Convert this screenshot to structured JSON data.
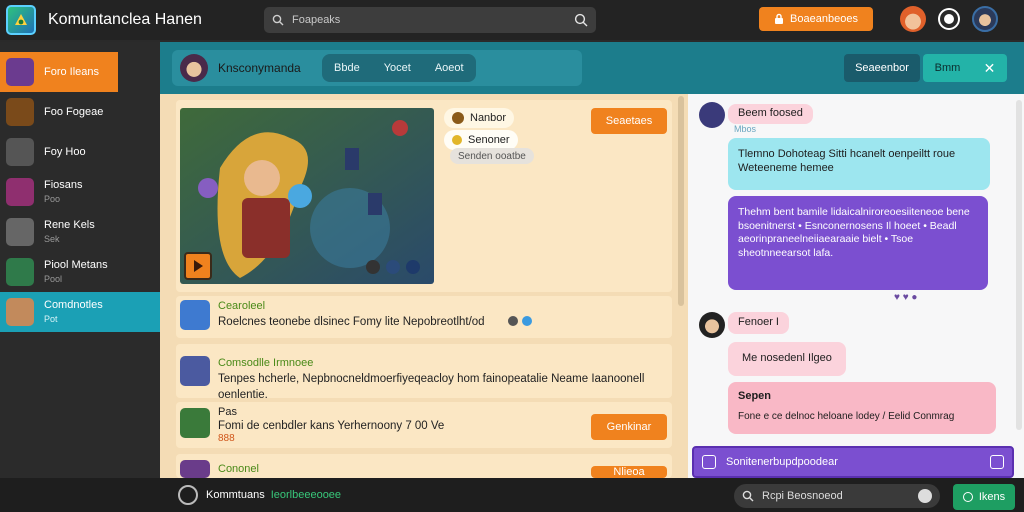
{
  "app": {
    "title": "Komuntanclea Hanen",
    "logo_icon": "game-logo-icon"
  },
  "search": {
    "placeholder": "Foapeaks"
  },
  "top_button": {
    "label": "Boaeanbeoes",
    "icon": "lock-icon"
  },
  "sidebar": {
    "items": [
      {
        "label": "Foro Ileans",
        "sub": "",
        "active": "orange",
        "avatar": "#6b3b8f"
      },
      {
        "label": "Foo Fogeae",
        "sub": "",
        "active": "",
        "avatar": "#7a4a1a"
      },
      {
        "label": "Foy Hoo",
        "sub": "",
        "active": "",
        "avatar": "#555555"
      },
      {
        "label": "Fiosans",
        "sub": "Poo",
        "active": "",
        "avatar": "#8f2f6f"
      },
      {
        "label": "Rene Kels",
        "sub": "Sek",
        "active": "",
        "avatar": "#666666"
      },
      {
        "label": "Piool Metans",
        "sub": "Pool",
        "active": "",
        "avatar": "#2f7a4a"
      },
      {
        "label": "Comdnotles",
        "sub": "Pot",
        "active": "teal",
        "avatar": "#c28a5c"
      }
    ]
  },
  "channel": {
    "name": "Knsconymanda",
    "tabs": [
      "Bbde",
      "Yocet",
      "Aoeot"
    ],
    "btn_dark": "Seaeenbor",
    "btn_teal": "Bmm"
  },
  "feed": {
    "chips": [
      {
        "label": "Nanbor",
        "icon": "gear-icon"
      },
      {
        "label": "Senoner",
        "icon": "coin-icon"
      },
      {
        "label": "Senden ooatbe",
        "icon": ""
      }
    ],
    "video_button": "Seaetaes",
    "posts": [
      {
        "name": "Cearoleel",
        "text": "Roelcnes teonebe dlsinec Fomy  lite Nepobreotlht/od",
        "avatar": "#3e7ad0"
      },
      {
        "name": "Comsodlle Irmnoee",
        "text": "Tenpes hcherle, Nepbnocneldmoerfiyeqeacloy hom fainopeatalie Neame Iaanoonell oenlentie.",
        "avatar": "#4b5aa0"
      },
      {
        "name": "Pas",
        "text": "Fomi de cenbdler kans Yerhernoony  7 00 Ve",
        "avatar": "#3a7a3a",
        "extra": "888",
        "button": "Genkinar"
      },
      {
        "name": "Cononel",
        "text": "",
        "avatar": "#6a3c8a",
        "button": "Nlieoa"
      }
    ]
  },
  "chat": {
    "messages": [
      {
        "text": "Beem foosed",
        "style": "pink",
        "tag": "Mbos"
      },
      {
        "text": "Tlemno Dohoteag  Sitti hcanelt oenpeiltt roue Weteeneme hemee",
        "style": "cyan"
      },
      {
        "text": "Thehm bent bamile  lidaicalniroreoesiiteneoe bene bsoenitnerst • Esnconernosens    Il hoeet • Beadl aeorinpraneelneiiaearaaie bielt • Tsoe sheotnneearsot lafa.",
        "style": "purple"
      },
      {
        "text": "Fenoer I",
        "style": "pink"
      },
      {
        "text": "Me nosedenl  Ilgeo",
        "style": "pink"
      },
      {
        "text": "Sepen",
        "style": "pink2",
        "extra": "Fone e ce delnoc heloane lodey / Eelid Conmrag"
      }
    ],
    "compose": "Sonitenerbupdpoodear"
  },
  "bottom": {
    "user_label": "Kommtuans",
    "status": "Ieorlbeeeooee",
    "search_placeholder": "Rcpi Beosnoeod",
    "send_label": "Ikens"
  },
  "colors": {
    "accent_orange": "#f0821e",
    "teal": "#1c7d8c",
    "feed_bg": "#f4dcb5",
    "purple": "#7b4fd0"
  }
}
